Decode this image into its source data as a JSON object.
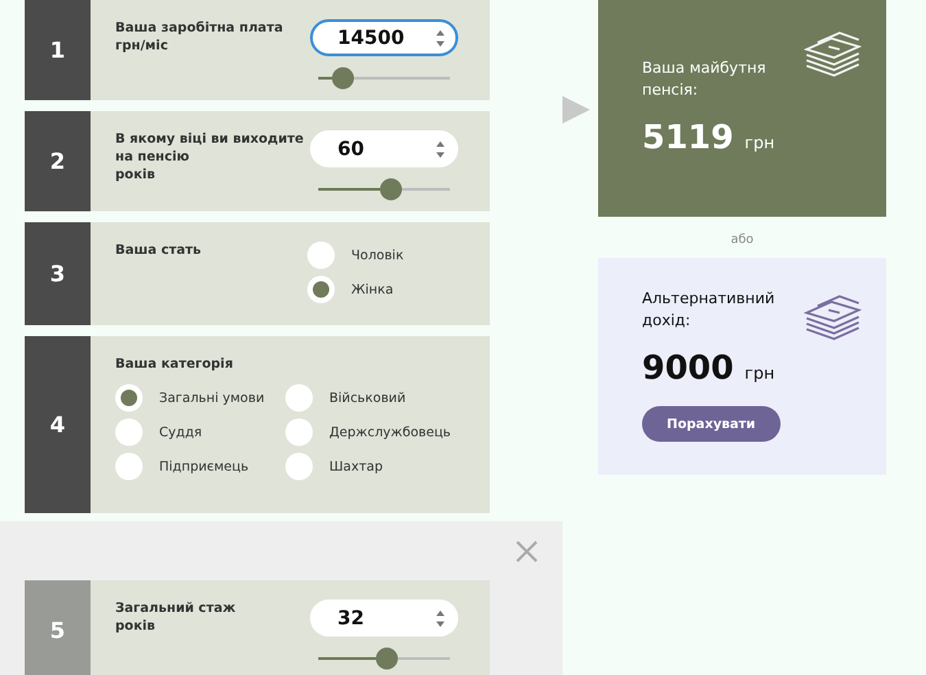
{
  "steps": [
    {
      "number": "1",
      "kind": "number",
      "muted": false,
      "label_lines": [
        "Ваша заробітна плата",
        "грн/міс"
      ],
      "value": "14500",
      "focused": true,
      "level": 0.12
    },
    {
      "number": "2",
      "kind": "number",
      "muted": false,
      "label_lines": [
        "В якому віці ви виходите",
        "на пенсію",
        "років"
      ],
      "value": "60",
      "focused": false,
      "level": 0.56
    },
    {
      "number": "3",
      "kind": "radio",
      "muted": false,
      "label_lines": [
        "Ваша стать"
      ],
      "options": [
        {
          "label": "Чоловік",
          "selected": false
        },
        {
          "label": "Жінка",
          "selected": true
        }
      ]
    },
    {
      "number": "4",
      "kind": "radio-grid",
      "muted": false,
      "label_lines": [
        "Ваша категорія"
      ],
      "options": [
        {
          "label": "Загальні умови",
          "selected": true
        },
        {
          "label": "Військовий",
          "selected": false
        },
        {
          "label": "Суддя",
          "selected": false
        },
        {
          "label": "Держслужбовець",
          "selected": false
        },
        {
          "label": "Підприємець",
          "selected": false
        },
        {
          "label": "Шахтар",
          "selected": false
        }
      ]
    }
  ],
  "overlay": {
    "steps": [
      {
        "number": "5",
        "kind": "number",
        "muted": true,
        "label_lines": [
          "Загальний стаж",
          "років"
        ],
        "value": "32",
        "focused": false,
        "level": 0.53
      }
    ]
  },
  "result": {
    "label_lines": [
      "Ваша майбутня",
      "пенсія:"
    ],
    "amount": "5119",
    "unit": "грн"
  },
  "separator": "або",
  "alternative": {
    "label_lines": [
      "Альтернативний",
      "дохід:"
    ],
    "amount": "9000",
    "unit": "грн",
    "button": "Порахувати"
  }
}
